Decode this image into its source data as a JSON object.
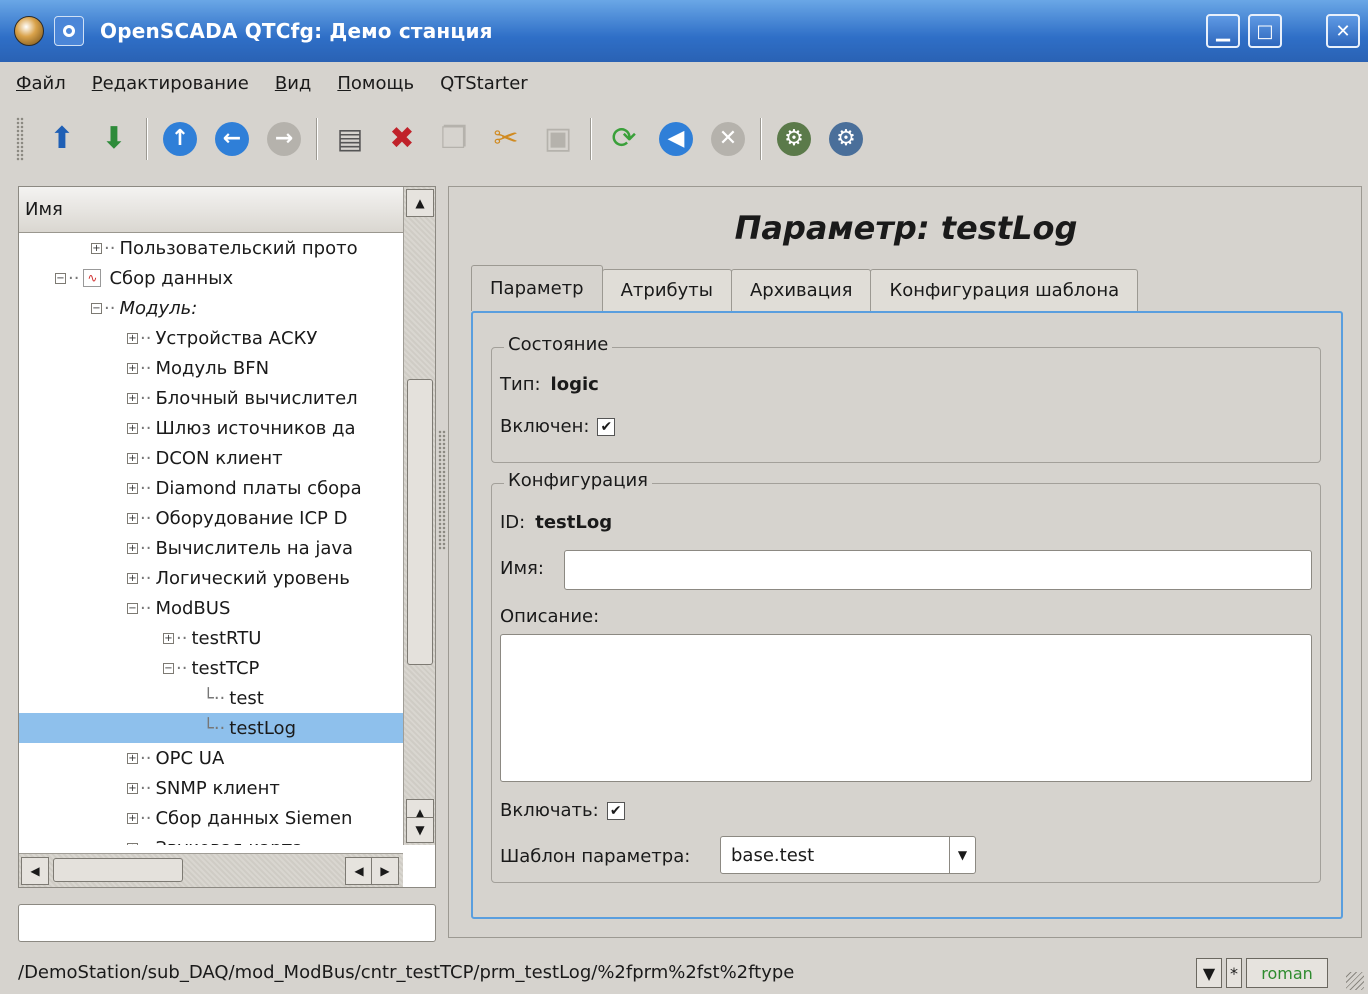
{
  "window": {
    "title": "OpenSCADA QTCfg: Демо станция"
  },
  "menu": [
    {
      "accel": "Ф",
      "rest": "айл"
    },
    {
      "accel": "Р",
      "rest": "едактирование"
    },
    {
      "accel": "В",
      "rest": "ид"
    },
    {
      "accel": "П",
      "rest": "омощь"
    },
    {
      "accel": "",
      "rest": "QTStarter"
    }
  ],
  "toolbar_icons": [
    "db-load-icon",
    "db-save-icon",
    "up-icon",
    "back-icon",
    "forward-icon",
    "add-item-icon",
    "delete-item-icon",
    "copy-icon",
    "cut-icon",
    "paste-icon",
    "refresh-icon",
    "start-icon",
    "stop-icon",
    "station-icon",
    "station-config-icon"
  ],
  "tree": {
    "header": "Имя",
    "rows": [
      {
        "text": "Пользовательский прото",
        "indent": 3,
        "exp": "+",
        "italic": false
      },
      {
        "text": "Сбор данных",
        "indent": 2,
        "exp": "-",
        "italic": false,
        "icon": true
      },
      {
        "text": "Модуль:",
        "indent": 3,
        "exp": "-",
        "italic": true
      },
      {
        "text": "Устройства АСКУ",
        "indent": 4,
        "exp": "+",
        "italic": false
      },
      {
        "text": "Модуль BFN",
        "indent": 4,
        "exp": "+",
        "italic": false
      },
      {
        "text": "Блочный вычислител",
        "indent": 4,
        "exp": "+",
        "italic": false
      },
      {
        "text": "Шлюз источников да",
        "indent": 4,
        "exp": "+",
        "italic": false
      },
      {
        "text": "DCON клиент",
        "indent": 4,
        "exp": "+",
        "italic": false
      },
      {
        "text": "Diamond платы сбора",
        "indent": 4,
        "exp": "+",
        "italic": false
      },
      {
        "text": "Оборудование ICP D",
        "indent": 4,
        "exp": "+",
        "italic": false
      },
      {
        "text": "Вычислитель на java",
        "indent": 4,
        "exp": "+",
        "italic": false
      },
      {
        "text": "Логический уровень",
        "indent": 4,
        "exp": "+",
        "italic": false
      },
      {
        "text": "ModBUS",
        "indent": 4,
        "exp": "-",
        "italic": false
      },
      {
        "text": "testRTU",
        "indent": 5,
        "exp": "+",
        "italic": false
      },
      {
        "text": "testTCP",
        "indent": 5,
        "exp": "-",
        "italic": false
      },
      {
        "text": "test",
        "indent": 6,
        "exp": "",
        "italic": false
      },
      {
        "text": "testLog",
        "indent": 6,
        "exp": "",
        "italic": false,
        "selected": true
      },
      {
        "text": "OPC UA",
        "indent": 4,
        "exp": "+",
        "italic": false
      },
      {
        "text": "SNMP клиент",
        "indent": 4,
        "exp": "+",
        "italic": false
      },
      {
        "text": "Сбор данных Siemen",
        "indent": 4,
        "exp": "+",
        "italic": false
      },
      {
        "text": "Звуковая карта",
        "indent": 4,
        "exp": "+",
        "italic": false
      }
    ]
  },
  "param": {
    "title": "Параметр: testLog",
    "tabs": [
      "Параметр",
      "Атрибуты",
      "Архивация",
      "Конфигурация шаблона"
    ],
    "state": {
      "group": "Состояние",
      "type_label": "Тип:",
      "type_value": "logic",
      "enabled_label": "Включен:",
      "enabled": true
    },
    "config": {
      "group": "Конфигурация",
      "id_label": "ID:",
      "id_value": "testLog",
      "name_label": "Имя:",
      "name_value": "",
      "descr_label": "Описание:",
      "descr_value": "",
      "enable_label": "Включать:",
      "enable": true,
      "template_label": "Шаблон параметра:",
      "template_value": "base.test"
    }
  },
  "status": {
    "path": "/DemoStation/sub_DAQ/mod_ModBus/cntr_testTCP/prm_testLog/%2fprm%2fst%2ftype",
    "modified": "*",
    "user": "roman",
    "user_color": "#2e8b2e"
  }
}
